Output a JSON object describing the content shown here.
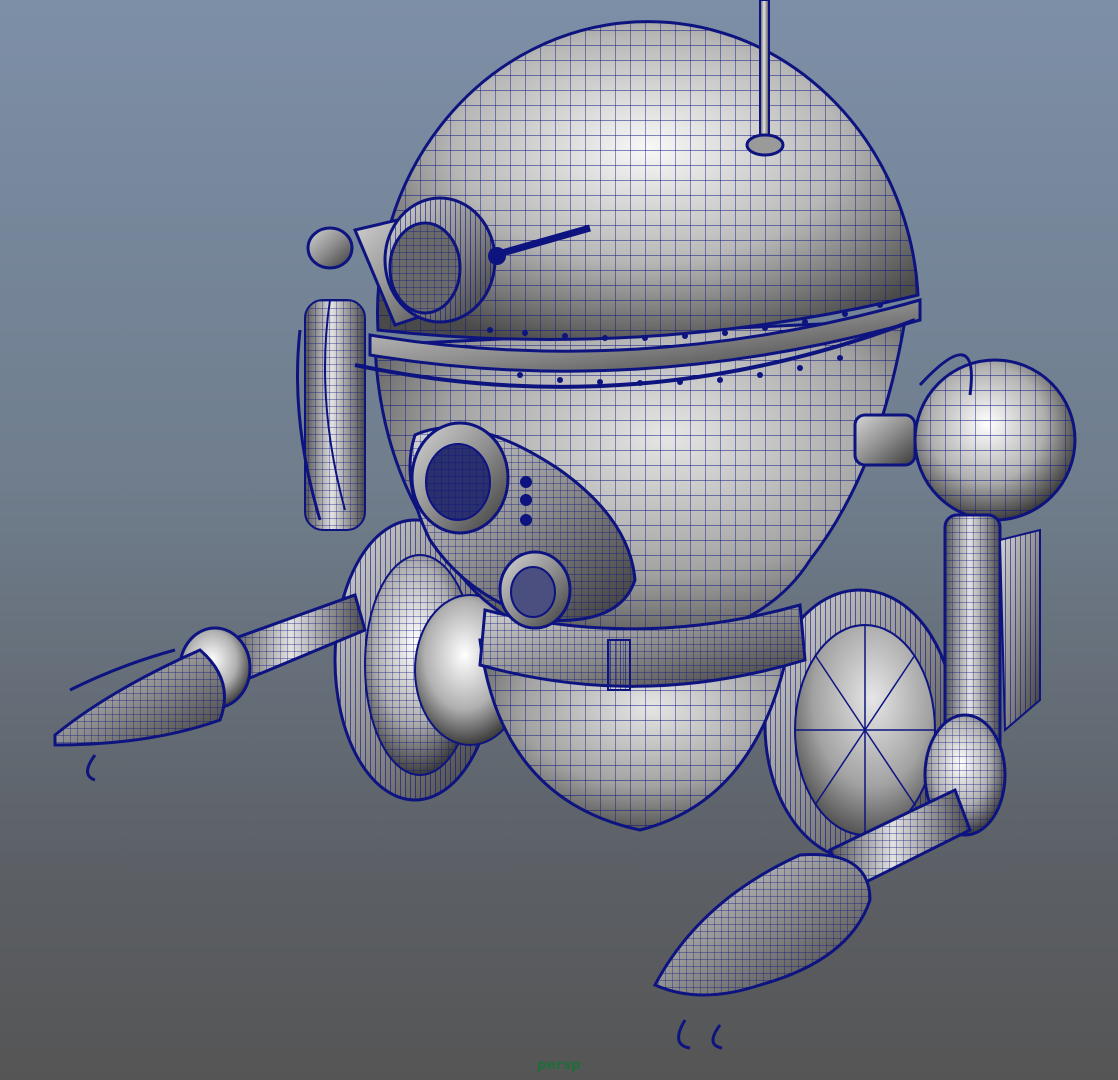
{
  "viewport": {
    "camera_label": "persp",
    "background_top": "#7d8fa7",
    "background_bottom": "#555555"
  },
  "model": {
    "wire_color": "#0d1480",
    "shade_light": "#f4f4f4",
    "shade_mid": "#a8a8a8",
    "shade_dark": "#3d3d3d"
  }
}
